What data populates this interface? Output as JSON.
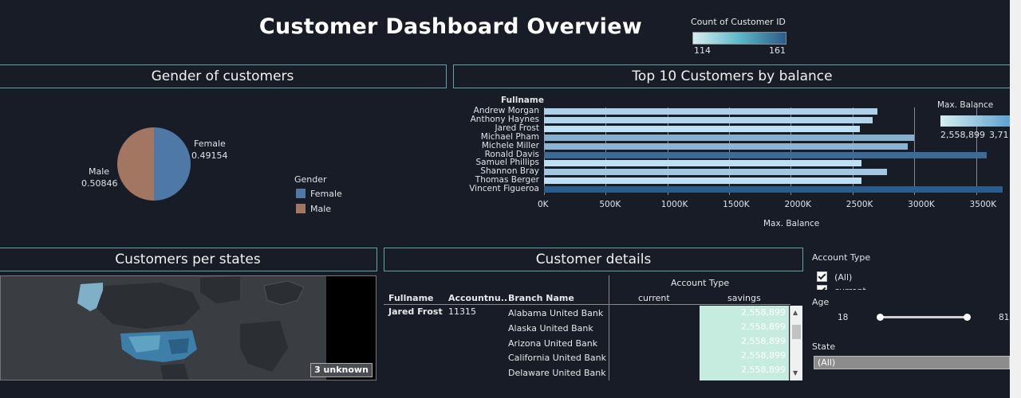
{
  "title": "Customer Dashboard Overview",
  "count_legend": {
    "title": "Count of Customer ID",
    "min": "114",
    "max": "161",
    "colors": [
      "#d6eef0",
      "#2b5c8a"
    ]
  },
  "gender_panel": {
    "title": "Gender of customers",
    "legend_title": "Gender",
    "slices": [
      {
        "label": "Female",
        "value": "0.49154",
        "color": "#4e79a7"
      },
      {
        "label": "Male",
        "value": "0.50846",
        "color": "#a37661"
      }
    ]
  },
  "top10_panel": {
    "title": "Top 10 Customers by balance",
    "row_header": "Fullname",
    "xlabel": "Max. Balance",
    "legend_title": "Max. Balance",
    "legend_min": "2,558,899",
    "legend_max": "3,71"
  },
  "chart_data": {
    "type": "bar",
    "orientation": "horizontal",
    "categories": [
      "Andrew Morgan",
      "Anthony Haynes",
      "Jared Frost",
      "Michael Pham",
      "Michele Miller",
      "Ronald Davis",
      "Samuel Phillips",
      "Shannon Bray",
      "Thomas Berger",
      "Vincent Figueroa"
    ],
    "values": [
      2700000,
      2660000,
      2558899,
      3000000,
      2950000,
      3590000,
      2570000,
      2780000,
      2570000,
      3719000
    ],
    "xticks": [
      "0K",
      "500K",
      "1000K",
      "1500K",
      "2000K",
      "2500K",
      "3000K",
      "3500K"
    ],
    "xlim": [
      0,
      3600000
    ],
    "xlabel": "Max. Balance",
    "ylabel": "Fullname"
  },
  "map_panel": {
    "title": "Customers per states",
    "unknown_badge": "3 unknown"
  },
  "details_panel": {
    "title": "Customer details",
    "group_header": "Account Type",
    "columns": [
      "Fullname",
      "Accountnu..",
      "Branch Name",
      "current",
      "savings"
    ],
    "fullname": "Jared Frost",
    "accountnum": "11315",
    "rows": [
      {
        "branch": "Alabama United Bank",
        "savings": "2,558,899"
      },
      {
        "branch": "Alaska United Bank",
        "savings": "2,558,899"
      },
      {
        "branch": "Arizona United Bank",
        "savings": "2,558,899"
      },
      {
        "branch": "California United Bank",
        "savings": "2,558,899"
      },
      {
        "branch": "Delaware United Bank",
        "savings": "2,558,899"
      }
    ]
  },
  "filters": {
    "account_type_label": "Account Type",
    "account_type_options": [
      "(All)",
      "current"
    ],
    "age_label": "Age",
    "age_min": "18",
    "age_max": "81",
    "state_label": "State",
    "state_value": "(All)"
  }
}
